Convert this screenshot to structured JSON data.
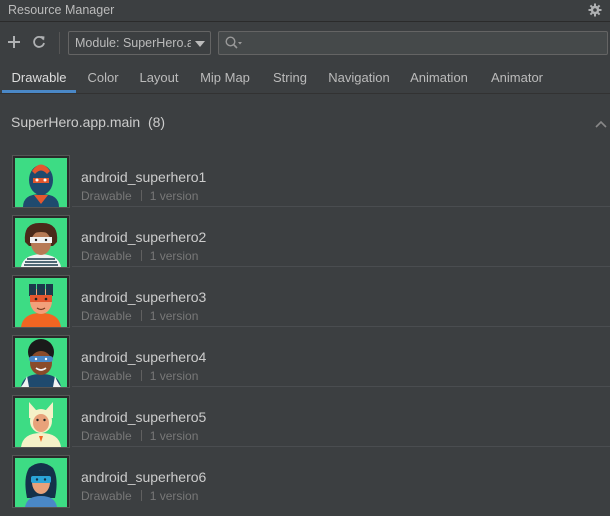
{
  "window": {
    "title": "Resource Manager"
  },
  "toolbar": {
    "add_icon": "plus-icon",
    "refresh_icon": "refresh-icon",
    "module_select": "Module: SuperHero.a",
    "search_placeholder": ""
  },
  "tabs": [
    {
      "label": "Drawable",
      "active": true
    },
    {
      "label": "Color"
    },
    {
      "label": "Layout"
    },
    {
      "label": "Mip Map"
    },
    {
      "label": "String"
    },
    {
      "label": "Navigation"
    },
    {
      "label": "Animation"
    },
    {
      "label": "Animator"
    }
  ],
  "group": {
    "title": "SuperHero.app.main",
    "count": "(8)"
  },
  "items": [
    {
      "name": "android_superhero1",
      "type": "Drawable",
      "versions": "1 version"
    },
    {
      "name": "android_superhero2",
      "type": "Drawable",
      "versions": "1 version"
    },
    {
      "name": "android_superhero3",
      "type": "Drawable",
      "versions": "1 version"
    },
    {
      "name": "android_superhero4",
      "type": "Drawable",
      "versions": "1 version"
    },
    {
      "name": "android_superhero5",
      "type": "Drawable",
      "versions": "1 version"
    },
    {
      "name": "android_superhero6",
      "type": "Drawable",
      "versions": "1 version"
    }
  ],
  "colors": {
    "panel_bg": "#3c3f41",
    "accent": "#4a88c7",
    "thumb_bg": "#3ddc84"
  }
}
